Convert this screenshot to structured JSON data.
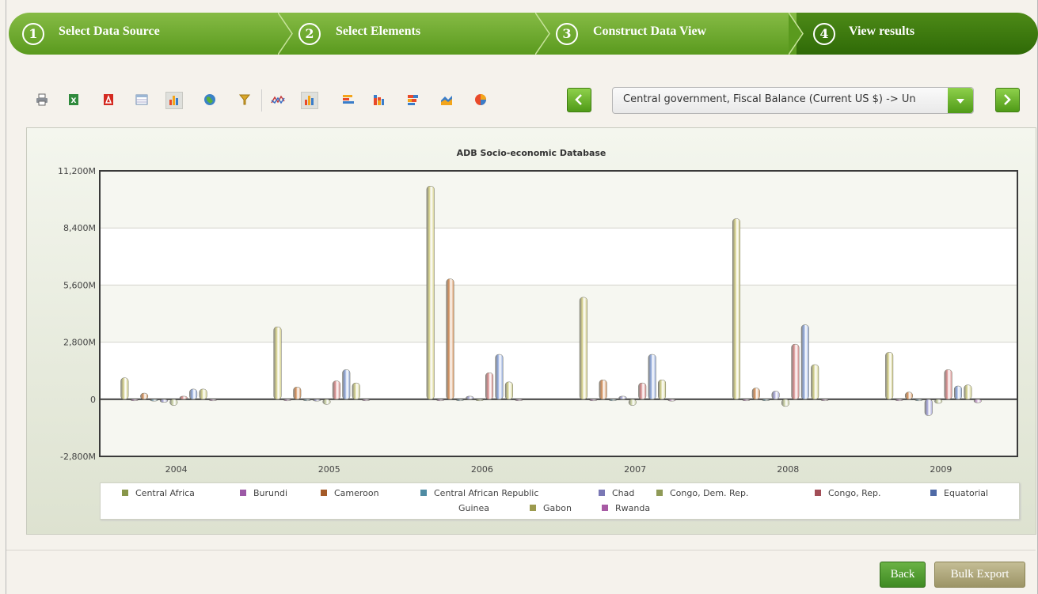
{
  "wizard": {
    "steps": [
      {
        "num": "1",
        "label": "Select Data Source"
      },
      {
        "num": "2",
        "label": "Select Elements"
      },
      {
        "num": "3",
        "label": "Construct Data View"
      },
      {
        "num": "4",
        "label": "View results"
      }
    ],
    "active_step": 4
  },
  "toolbar": {
    "icons": [
      "print-icon",
      "excel-export-icon",
      "pdf-export-icon",
      "table-view-icon",
      "chart-view-icon",
      "map-view-icon",
      "filter-icon",
      "line-chart-icon",
      "column-chart-icon",
      "bar-chart-icon",
      "stacked-column-icon",
      "stacked-bar-icon",
      "area-chart-icon",
      "pie-chart-icon"
    ],
    "selected": [
      "chart-view-icon",
      "column-chart-icon"
    ]
  },
  "indicator_select": {
    "value": "Central government, Fiscal Balance (Current US $) -> Un"
  },
  "buttons": {
    "back": "Back",
    "bulk_export": "Bulk Export"
  },
  "colors": {
    "wizard_green": "#5a9a1e",
    "wizard_active": "#2f6a07",
    "accent": "#6ab245"
  },
  "chart_data": {
    "type": "bar",
    "title": "ADB Socio-economic Database",
    "xlabel": "",
    "ylabel": "",
    "ylim": [
      -2800,
      11200
    ],
    "yticks": [
      "-2,800M",
      "0",
      "2,800M",
      "5,600M",
      "8,400M",
      "11,200M"
    ],
    "ytick_values": [
      -2800,
      0,
      2800,
      5600,
      8400,
      11200
    ],
    "categories": [
      "2004",
      "2005",
      "2006",
      "2007",
      "2008",
      "2009"
    ],
    "grid": true,
    "legend_position": "bottom",
    "series": [
      {
        "name": "Central Africa",
        "color": "#d4cf86",
        "values": [
          1050,
          3550,
          10450,
          5000,
          8850,
          2300
        ]
      },
      {
        "name": "Burundi",
        "color": "#c79ad0",
        "values": [
          -60,
          -40,
          -60,
          -70,
          -60,
          -60
        ]
      },
      {
        "name": "Cameroon",
        "color": "#d6915a",
        "values": [
          300,
          600,
          5900,
          950,
          550,
          350
        ]
      },
      {
        "name": "Central African Republic",
        "color": "#8cb0c8",
        "values": [
          -90,
          -70,
          -50,
          -50,
          -50,
          -50
        ]
      },
      {
        "name": "Chad",
        "color": "#a5a5d6",
        "values": [
          -150,
          -90,
          150,
          150,
          400,
          -800
        ]
      },
      {
        "name": "Congo, Dem. Rep.",
        "color": "#c8d0a0",
        "values": [
          -300,
          -250,
          -50,
          -300,
          -350,
          -200
        ]
      },
      {
        "name": "Congo, Rep.",
        "color": "#d98c8c",
        "values": [
          150,
          900,
          1300,
          800,
          2700,
          1450
        ]
      },
      {
        "name": "Equatorial Guinea",
        "color": "#8fa8dc",
        "values": [
          500,
          1450,
          2200,
          2200,
          3650,
          650
        ]
      },
      {
        "name": "Gabon",
        "color": "#d2d08a",
        "values": [
          500,
          800,
          850,
          950,
          1700,
          700
        ]
      },
      {
        "name": "Rwanda",
        "color": "#c9a3d0",
        "values": [
          -40,
          -40,
          -40,
          -90,
          -30,
          -170
        ]
      }
    ],
    "legend_swatch_colors": [
      "#88964a",
      "#9c59a6",
      "#a45a28",
      "#4f8ba3",
      "#7a78b5",
      "#8f9a57",
      "#a24e57",
      "#4f6aa6",
      "#9c9a4e",
      "#a75aa4"
    ],
    "legend_rows": [
      [
        "Central Africa",
        "Burundi",
        "Cameroon",
        "Central African Republic",
        "Chad",
        "Congo, Dem. Rep.",
        "Congo, Rep.",
        "Equatorial"
      ],
      [
        "Guinea",
        "Gabon",
        "Rwanda"
      ]
    ]
  }
}
